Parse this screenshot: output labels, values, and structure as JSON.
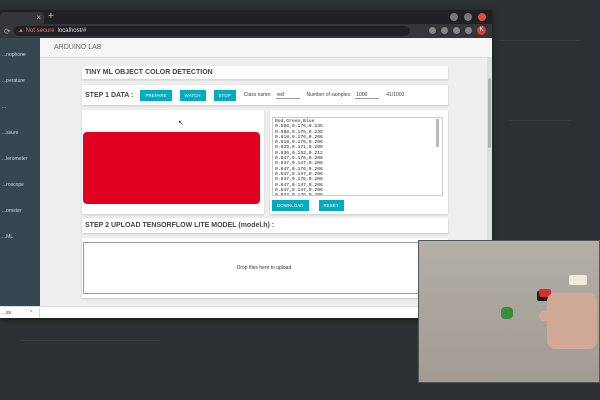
{
  "browser": {
    "tab_close": "×",
    "new_tab": "+",
    "security_label": "▲ Not secure",
    "url": "localhost/#",
    "avatar_letter": "K"
  },
  "app": {
    "header_title": "ARDUINO LAB",
    "sidebar_items": [
      "...nophone",
      "...perature",
      "...",
      "...ssure",
      "...lerometer",
      "...roscope",
      "...ometer",
      "...ML"
    ]
  },
  "page": {
    "title": "TINY ML OBJECT COLOR DETECTION",
    "step1": {
      "label": "STEP 1 DATA :",
      "prepare": "PREPARE",
      "watch": "WATCH",
      "stop": "STOP",
      "class_label": "Class name:",
      "class_value": "red",
      "samples_label": "Number of samples:",
      "samples_value": "1000",
      "counter": "41/1000"
    },
    "swatch_color": "#e00020",
    "data_text": "Red,Green,Blue\n0.588,0.176,0.235\n0.588,0.176,0.235\n0.618,0.176,0.206\n0.618,0.176,0.206\n0.629,0.171,0.200\n0.636,0.152,0.212\n0.647,0.176,0.206\n0.647,0.147,0.206\n0.647,0.176,0.206\n0.647,0.147,0.206\n0.647,0.176,0.206\n0.647,0.147,0.206\n0.647,0.147,0.206\n0.647,0.176,0.206",
    "download": "DOWNLOAD",
    "reset": "RESET",
    "step2_label": "STEP 2 UPLOAD TENSORFLOW LITE MODEL (model.h) :",
    "drop_text": "Drop files here to upload"
  },
  "download_bar": {
    "item": "...sv",
    "chevron": "^"
  },
  "colors": {
    "accent": "#00acc1",
    "sidebar": "#37474f"
  }
}
